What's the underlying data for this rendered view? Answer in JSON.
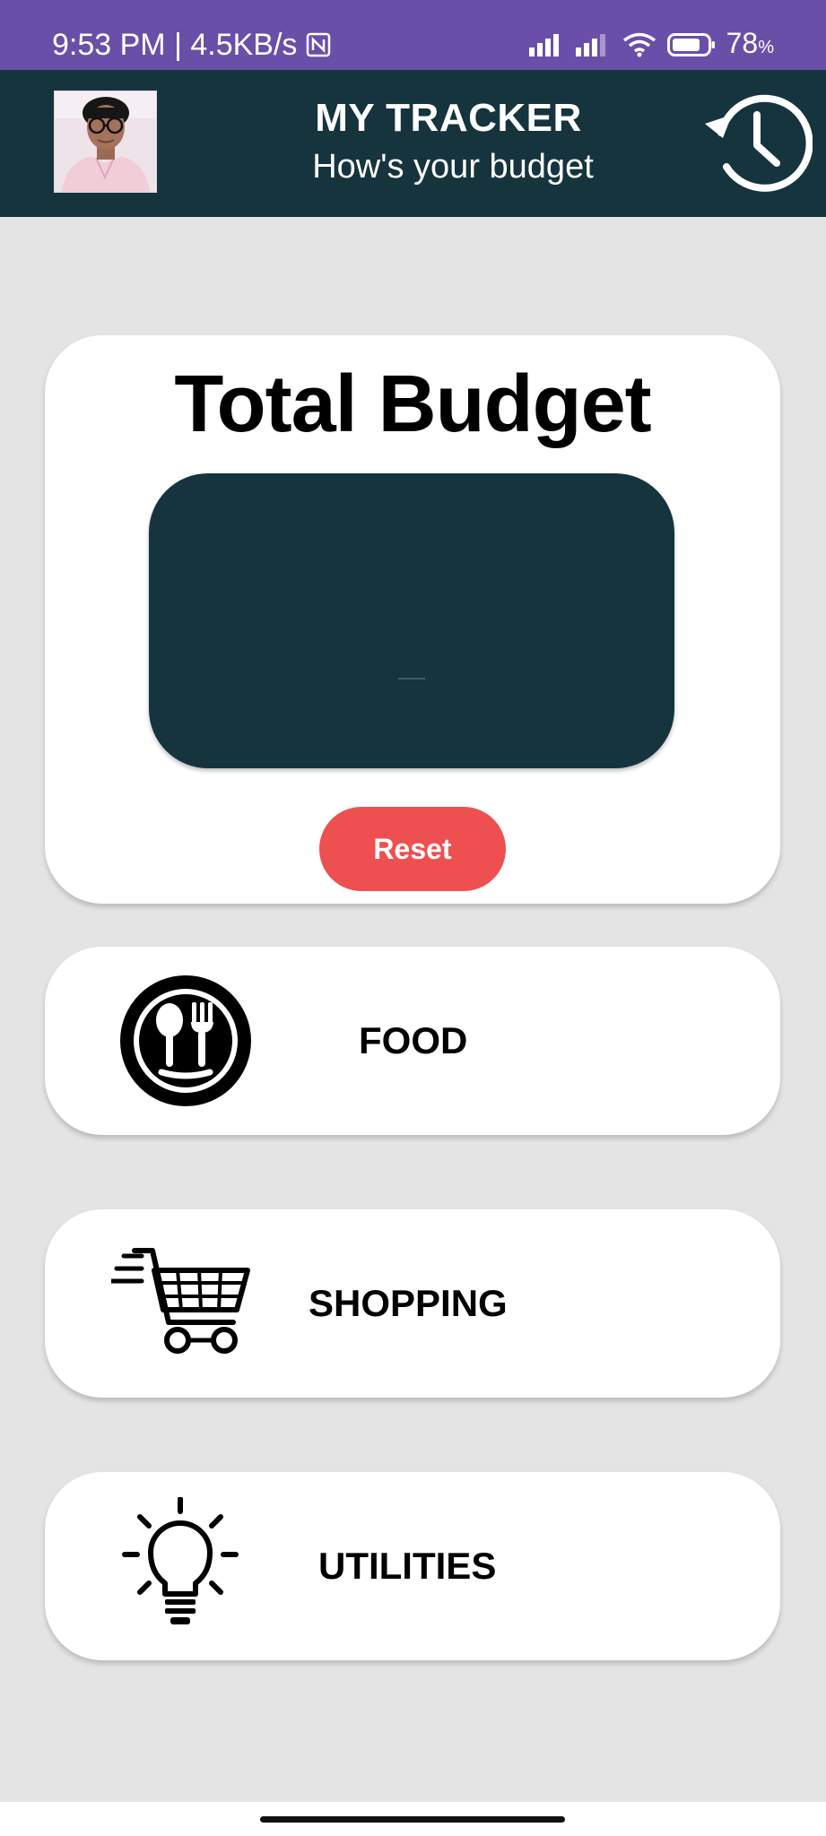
{
  "status_bar": {
    "time_speed": "9:53 PM | 4.5KB/s",
    "battery": "78",
    "battery_unit": "%",
    "icons": [
      "nfc-icon",
      "signal-icon",
      "signal-icon",
      "wifi-icon",
      "battery-icon"
    ]
  },
  "header": {
    "title": "MY TRACKER",
    "subtitle": "How's your budget",
    "history_icon": "history-clock-icon"
  },
  "budget": {
    "title": "Total Budget",
    "value": "",
    "reset_label": "Reset"
  },
  "categories": [
    {
      "label": "FOOD",
      "icon": "food-plate-icon"
    },
    {
      "label": "SHOPPING",
      "icon": "shopping-cart-icon"
    },
    {
      "label": "UTILITIES",
      "icon": "lightbulb-icon"
    }
  ],
  "colors": {
    "status_bar": "#6a4fa8",
    "app_bar": "#15343e",
    "background": "#e4e4e4",
    "reset_button": "#ee5052",
    "card": "#ffffff"
  }
}
